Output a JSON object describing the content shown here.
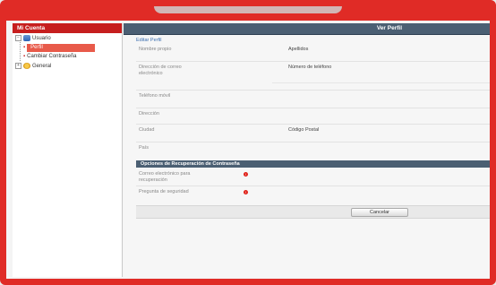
{
  "sidebar": {
    "title": "Mi Cuenta",
    "tree": {
      "usuario": {
        "label": "Usuario",
        "expander": "−"
      },
      "perfil": {
        "label": "Perfil"
      },
      "cambiar": {
        "label": "Cambiar Contraseña"
      },
      "general": {
        "label": "General",
        "expander": "+"
      }
    }
  },
  "main": {
    "title": "Ver Perfil",
    "edit_link": "Editar Perfil",
    "fields": [
      {
        "label": "Nombre propio",
        "value": "Apellidos"
      },
      {
        "label": "Dirección de correo electrónico",
        "value": "Número de teléfono"
      },
      {
        "label": "Teléfono móvil",
        "value": ""
      },
      {
        "label": "Dirección",
        "value": ""
      },
      {
        "label": "Ciudad",
        "value": "Código Postal"
      },
      {
        "label": "País",
        "value": ""
      }
    ],
    "recovery": {
      "title": "Opciones de Recuperación de Contraseña",
      "fields": [
        {
          "label": "Correo electrónico para recuperación",
          "required_mark": "!"
        },
        {
          "label": "Pregunta de seguridad",
          "required_mark": "!"
        }
      ]
    },
    "cancel_button": "Cancelar"
  },
  "colors": {
    "frame": "#e02b26",
    "sidebar_header": "#c61e1e",
    "selected": "#e85a4a",
    "title_bar": "#4b5f73",
    "required": "#e0221a"
  },
  "icons": {
    "usuario": "users-icon",
    "general": "gear-icon"
  }
}
